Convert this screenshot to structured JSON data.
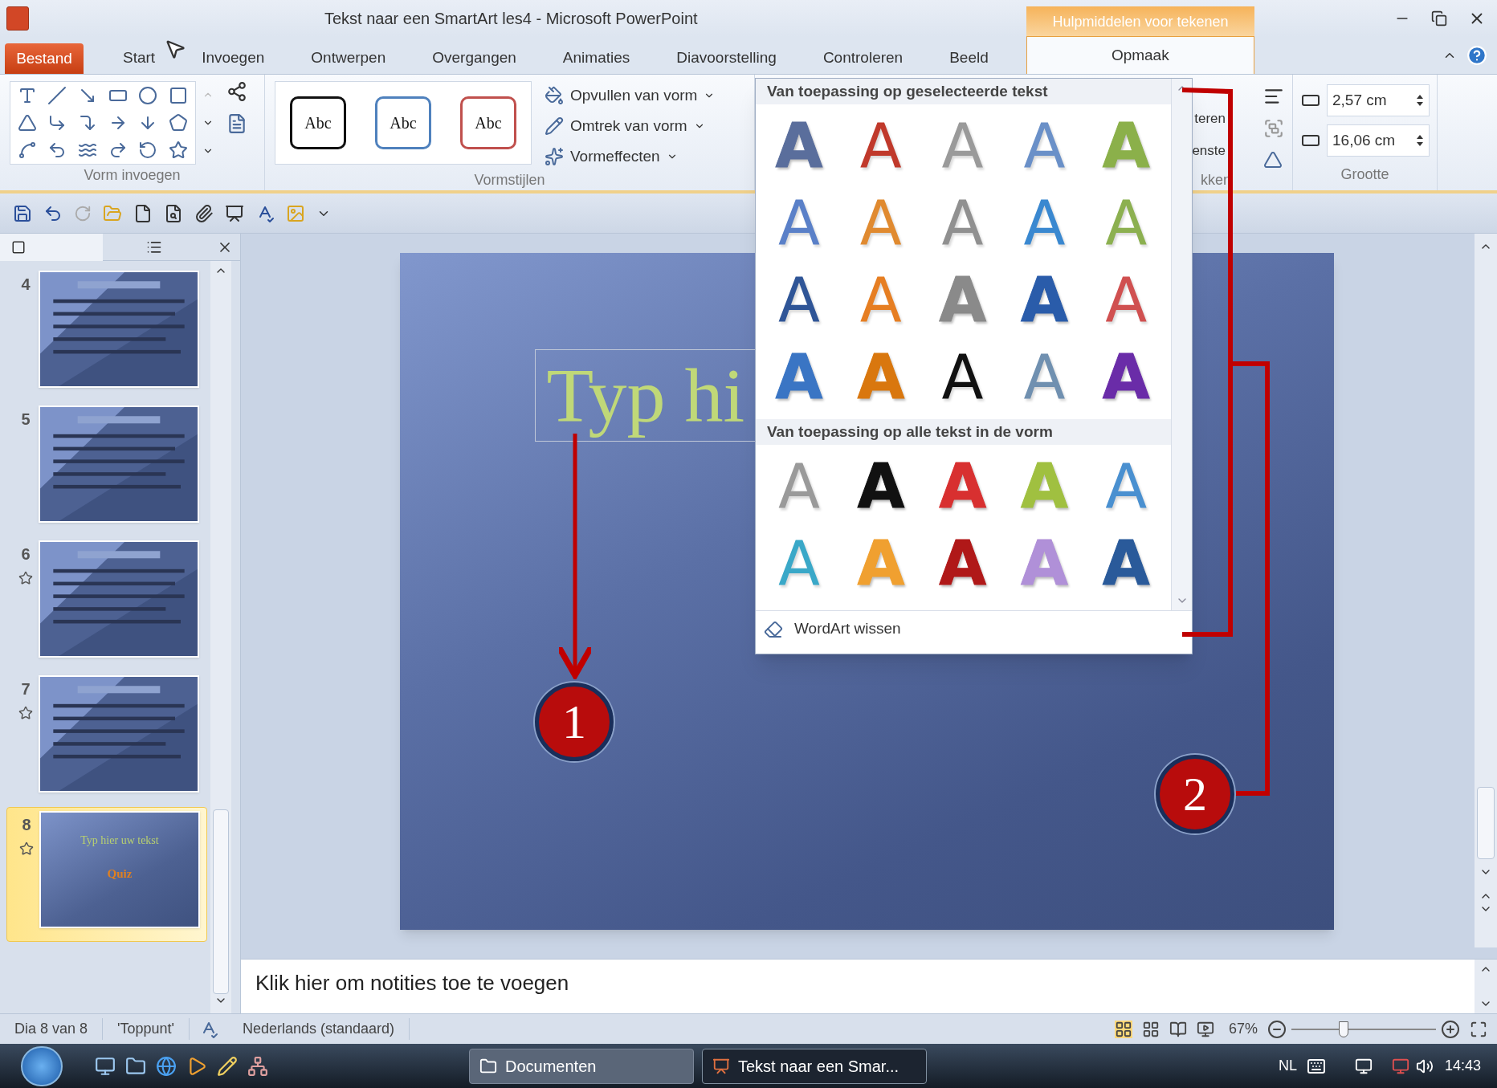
{
  "window": {
    "title": "Tekst naar een SmartArt les4  -  Microsoft PowerPoint"
  },
  "contextual_tab_group": {
    "label": "Hulpmiddelen voor tekenen"
  },
  "tabs": [
    {
      "label": "Bestand",
      "kind": "file",
      "selected": false
    },
    {
      "label": "Start",
      "kind": "tab",
      "selected": false
    },
    {
      "label": "Invoegen",
      "kind": "tab",
      "selected": false
    },
    {
      "label": "Ontwerpen",
      "kind": "tab",
      "selected": false
    },
    {
      "label": "Overgangen",
      "kind": "tab",
      "selected": false
    },
    {
      "label": "Animaties",
      "kind": "tab",
      "selected": false
    },
    {
      "label": "Diavoorstelling",
      "kind": "tab",
      "selected": false
    },
    {
      "label": "Controleren",
      "kind": "tab",
      "selected": false
    },
    {
      "label": "Beeld",
      "kind": "tab",
      "selected": false
    },
    {
      "label": "Opmaak",
      "kind": "contextual",
      "selected": true
    }
  ],
  "ribbon": {
    "insert_shapes": {
      "label": "Vorm invoegen"
    },
    "shape_styles": {
      "label": "Vormstijlen",
      "styles": [
        {
          "text": "Abc",
          "color": "#111111"
        },
        {
          "text": "Abc",
          "color": "#4f81bd"
        },
        {
          "text": "Abc",
          "color": "#c0504d"
        }
      ],
      "commands": [
        "Opvullen van vorm",
        "Omtrek van vorm",
        "Vormeffecten"
      ]
    },
    "arrange": {
      "label": "kken",
      "commands": [
        "teren",
        "enste"
      ]
    },
    "size": {
      "label": "Grootte",
      "height": "2,57 cm",
      "width": "16,06 cm"
    }
  },
  "wordart_gallery": {
    "sections": [
      {
        "heading": "Van toepassing op geselecteerde tekst",
        "items": [
          {
            "text": "A",
            "kind": "fill",
            "color": "#5a6e9c"
          },
          {
            "text": "A",
            "kind": "outline",
            "color": "#c0392b"
          },
          {
            "text": "A",
            "kind": "outline",
            "color": "#9a9a9a"
          },
          {
            "text": "A",
            "kind": "outline",
            "color": "#6a90c8"
          },
          {
            "text": "A",
            "kind": "fill",
            "color": "#8bb04a"
          },
          {
            "text": "A",
            "kind": "outline",
            "color": "#5a80c8"
          },
          {
            "text": "A",
            "kind": "outline",
            "color": "#e08a30"
          },
          {
            "text": "A",
            "kind": "outline",
            "color": "#909090"
          },
          {
            "text": "A",
            "kind": "outline",
            "color": "#3a88d0"
          },
          {
            "text": "A",
            "kind": "outline",
            "color": "#8cb050"
          },
          {
            "text": "A",
            "kind": "outline",
            "color": "#2f5597"
          },
          {
            "text": "A",
            "kind": "outline",
            "color": "#e67e22"
          },
          {
            "text": "A",
            "kind": "fill",
            "color": "#8a8a8a"
          },
          {
            "text": "A",
            "kind": "fill",
            "color": "#2a5caa"
          },
          {
            "text": "A",
            "kind": "outline",
            "color": "#d05050"
          },
          {
            "text": "A",
            "kind": "fill",
            "color": "#3a75c4"
          },
          {
            "text": "A",
            "kind": "fill",
            "color": "#d9770e"
          },
          {
            "text": "A",
            "kind": "outline",
            "color": "#111111"
          },
          {
            "text": "A",
            "kind": "outline",
            "color": "#7090b0"
          },
          {
            "text": "A",
            "kind": "fill",
            "color": "#6a2ca8"
          }
        ]
      },
      {
        "heading": "Van toepassing op alle tekst in de vorm",
        "items": [
          {
            "text": "A",
            "kind": "outline",
            "color": "#9a9a9a"
          },
          {
            "text": "A",
            "kind": "fill",
            "color": "#111111"
          },
          {
            "text": "A",
            "kind": "fill",
            "color": "#d83030"
          },
          {
            "text": "A",
            "kind": "fill",
            "color": "#a0c040"
          },
          {
            "text": "A",
            "kind": "outline",
            "color": "#4a90d0"
          },
          {
            "text": "A",
            "kind": "outline",
            "color": "#3aa8c8"
          },
          {
            "text": "A",
            "kind": "fill",
            "color": "#f0a030"
          },
          {
            "text": "A",
            "kind": "fill",
            "color": "#b01818"
          },
          {
            "text": "A",
            "kind": "fill",
            "color": "#b090d8"
          },
          {
            "text": "A",
            "kind": "fill",
            "color": "#2a5a9a"
          }
        ]
      }
    ],
    "clear_command": "WordArt wissen"
  },
  "slides_panel": {
    "slides": [
      {
        "number": "4",
        "has_animation": false,
        "selected": false
      },
      {
        "number": "5",
        "has_animation": false,
        "selected": false
      },
      {
        "number": "6",
        "has_animation": true,
        "selected": false
      },
      {
        "number": "7",
        "has_animation": true,
        "selected": false
      },
      {
        "number": "8",
        "has_animation": true,
        "selected": true,
        "title": "Typ hier uw tekst",
        "subtitle": "Quiz"
      }
    ]
  },
  "slide": {
    "title_text": "Typ hi"
  },
  "notes": {
    "prompt": "Klik hier om notities toe te voegen"
  },
  "status_bar": {
    "slide": "Dia 8 van 8",
    "theme": "'Toppunt'",
    "language": "Nederlands (standaard)",
    "zoom": "67%",
    "zoom_slider": {
      "level": 0.36
    }
  },
  "taskbar": {
    "buttons": [
      {
        "label": "Documenten",
        "selected": false
      },
      {
        "label": "Tekst naar een Smar...",
        "selected": true
      }
    ],
    "language": "NL",
    "time": "14:43"
  },
  "callouts": [
    "1",
    "2"
  ]
}
